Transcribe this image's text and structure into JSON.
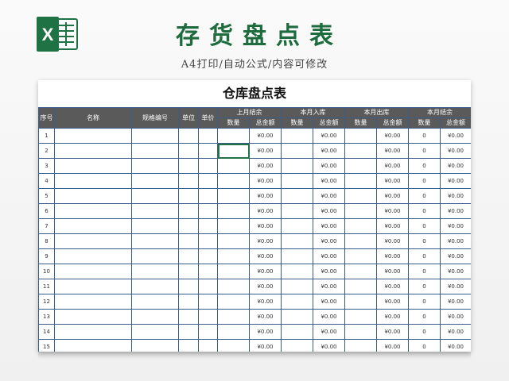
{
  "header": {
    "title": "存货盘点表",
    "subtitle": "A4打印/自动公式/内容可修改"
  },
  "logo": {
    "letter": "X",
    "color": "#1f7244"
  },
  "sheet": {
    "title": "仓库盘点表",
    "columns": {
      "seq": "序号",
      "name": "名称",
      "spec": "规格编号",
      "unit": "单位",
      "price": "单价",
      "groups": [
        "上月结余",
        "本月入库",
        "本月出库",
        "本月结余"
      ],
      "qty": "数量",
      "amount": "总金额"
    },
    "rows": [
      {
        "seq": "1",
        "amt1": "¥0.00",
        "amt2": "¥0.00",
        "amt3": "¥0.00",
        "qty4": "0",
        "amt4": "¥0.00"
      },
      {
        "seq": "2",
        "amt1": "¥0.00",
        "amt2": "¥0.00",
        "amt3": "¥0.00",
        "qty4": "0",
        "amt4": "¥0.00"
      },
      {
        "seq": "3",
        "amt1": "¥0.00",
        "amt2": "¥0.00",
        "amt3": "¥0.00",
        "qty4": "0",
        "amt4": "¥0.00"
      },
      {
        "seq": "4",
        "amt1": "¥0.00",
        "amt2": "¥0.00",
        "amt3": "¥0.00",
        "qty4": "0",
        "amt4": "¥0.00"
      },
      {
        "seq": "5",
        "amt1": "¥0.00",
        "amt2": "¥0.00",
        "amt3": "¥0.00",
        "qty4": "0",
        "amt4": "¥0.00"
      },
      {
        "seq": "6",
        "amt1": "¥0.00",
        "amt2": "¥0.00",
        "amt3": "¥0.00",
        "qty4": "0",
        "amt4": "¥0.00"
      },
      {
        "seq": "7",
        "amt1": "¥0.00",
        "amt2": "¥0.00",
        "amt3": "¥0.00",
        "qty4": "0",
        "amt4": "¥0.00"
      },
      {
        "seq": "8",
        "amt1": "¥0.00",
        "amt2": "¥0.00",
        "amt3": "¥0.00",
        "qty4": "0",
        "amt4": "¥0.00"
      },
      {
        "seq": "9",
        "amt1": "¥0.00",
        "amt2": "¥0.00",
        "amt3": "¥0.00",
        "qty4": "0",
        "amt4": "¥0.00"
      },
      {
        "seq": "10",
        "amt1": "¥0.00",
        "amt2": "¥0.00",
        "amt3": "¥0.00",
        "qty4": "0",
        "amt4": "¥0.00"
      },
      {
        "seq": "11",
        "amt1": "¥0.00",
        "amt2": "¥0.00",
        "amt3": "¥0.00",
        "qty4": "0",
        "amt4": "¥0.00"
      },
      {
        "seq": "12",
        "amt1": "¥0.00",
        "amt2": "¥0.00",
        "amt3": "¥0.00",
        "qty4": "0",
        "amt4": "¥0.00"
      },
      {
        "seq": "13",
        "amt1": "¥0.00",
        "amt2": "¥0.00",
        "amt3": "¥0.00",
        "qty4": "0",
        "amt4": "¥0.00"
      },
      {
        "seq": "14",
        "amt1": "¥0.00",
        "amt2": "¥0.00",
        "amt3": "¥0.00",
        "qty4": "0",
        "amt4": "¥0.00"
      },
      {
        "seq": "15",
        "amt1": "¥0.00",
        "amt2": "¥0.00",
        "amt3": "¥0.00",
        "qty4": "0",
        "amt4": "¥0.00"
      }
    ]
  }
}
